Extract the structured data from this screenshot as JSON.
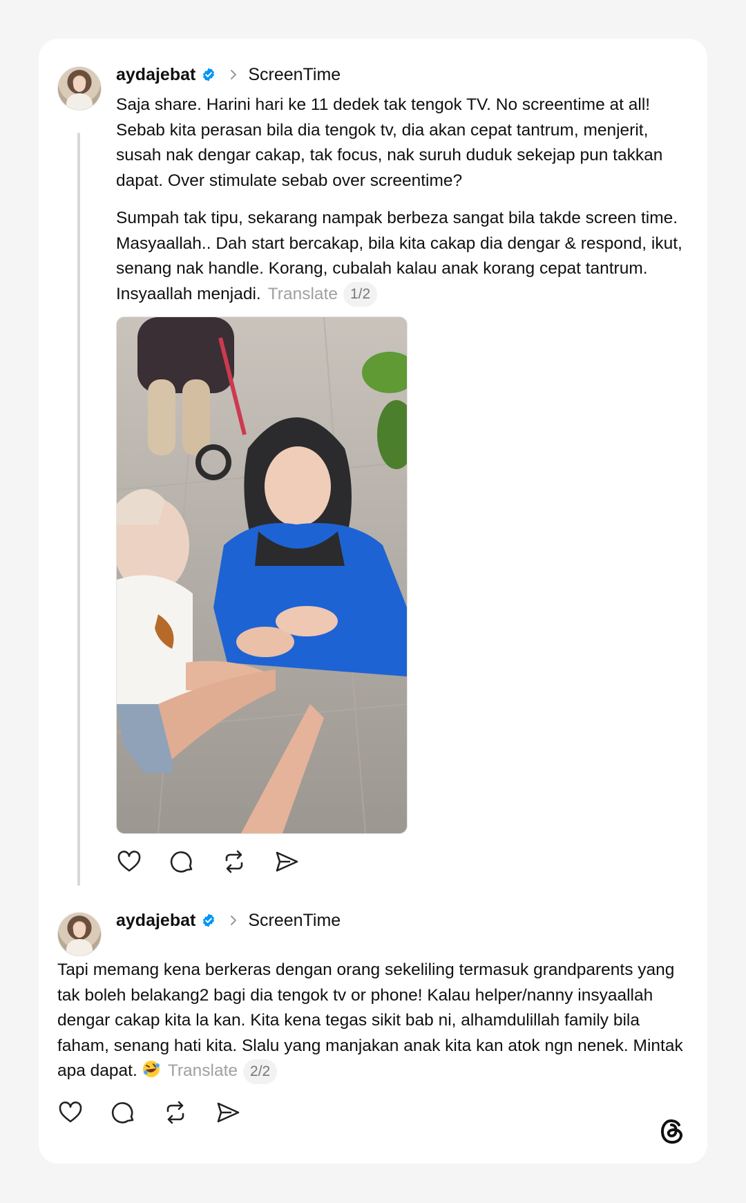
{
  "posts": [
    {
      "username": "aydajebat",
      "verified": true,
      "topic": "ScreenTime",
      "paragraphs": [
        "Saja share. Harini hari ke 11 dedek tak tengok TV. No screentime at all! Sebab kita perasan bila dia tengok tv, dia akan cepat tantrum, menjerit, susah nak dengar cakap, tak focus, nak suruh duduk sekejap pun takkan dapat. Over stimulate sebab over screentime?",
        "Sumpah tak tipu, sekarang nampak berbeza sangat bila takde screen time. Masyaallah.. Dah start bercakap, bila kita cakap dia dengar & respond, ikut, senang nak handle. Korang, cubalah kalau anak korang cepat tantrum. Insyaallah menjadi."
      ],
      "translate_label": "Translate",
      "pager": "1/2",
      "has_media": true,
      "actions": [
        "like-icon",
        "comment-icon",
        "repost-icon",
        "share-icon"
      ]
    },
    {
      "username": "aydajebat",
      "verified": true,
      "topic": "ScreenTime",
      "paragraphs": [
        "Tapi memang kena berkeras dengan orang sekeliling termasuk grandparents yang tak boleh belakang2 bagi dia tengok tv or phone! Kalau helper/nanny insyaallah dengar cakap kita la kan. Kita kena tegas sikit bab ni, alhamdulillah family bila faham, senang hati kita. Slalu yang manjakan anak kita kan atok ngn nenek. Mintak apa dapat."
      ],
      "emoji": "rolling-on-floor-laughing-emoji",
      "translate_label": "Translate",
      "pager": "2/2",
      "actions": [
        "like-icon",
        "comment-icon",
        "repost-icon",
        "share-icon"
      ]
    }
  ],
  "brand": {
    "logo": "threads-logo-icon",
    "accent": "#0095f6"
  }
}
